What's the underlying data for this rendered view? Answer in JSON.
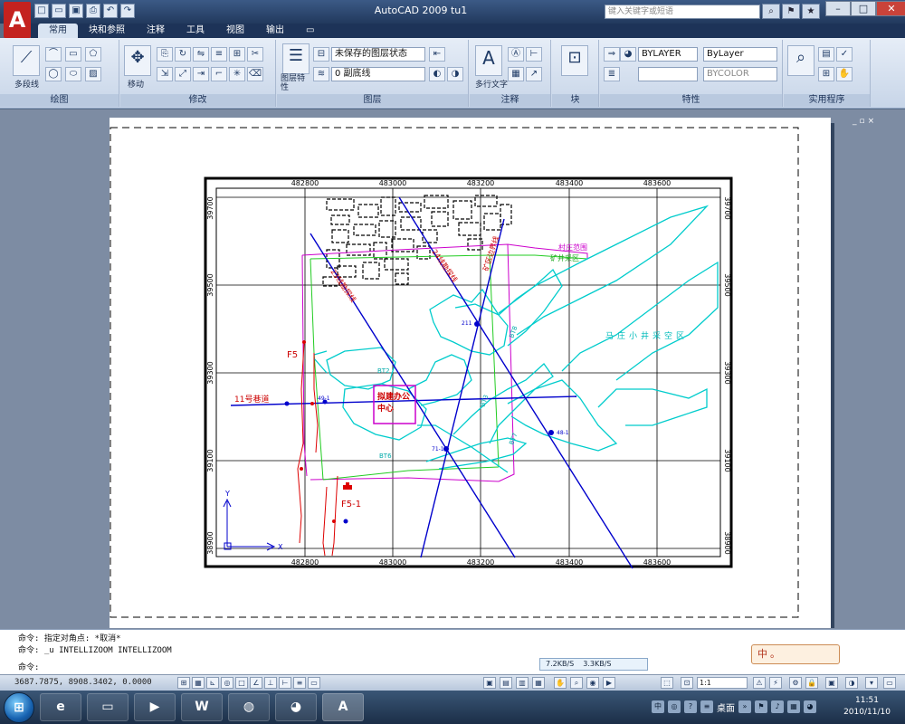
{
  "window": {
    "title": "AutoCAD 2009 tu1",
    "help_search_placeholder": "键入关键字或短语",
    "app_letter": "A"
  },
  "quick_access": [
    "new-icon",
    "open-icon",
    "save-icon",
    "plot-icon",
    "undo-icon",
    "redo-icon"
  ],
  "ribbon": {
    "tabs": [
      "常用",
      "块和参照",
      "注释",
      "工具",
      "视图",
      "输出"
    ],
    "active_tab": 0,
    "panels": {
      "draw": {
        "title": "绘图",
        "polyline_label": "多段线"
      },
      "modify": {
        "title": "修改",
        "move_label": "移动"
      },
      "layers": {
        "title": "图层",
        "layer_state": "未保存的图层状态",
        "current_layer": "0 副底线",
        "layer_props_label": "图层特性"
      },
      "annotation": {
        "title": "注释",
        "mtext_label": "多行文字"
      },
      "block": {
        "title": "块"
      },
      "properties": {
        "title": "特性",
        "color": "BYLAYER",
        "linetype": "ByLayer",
        "lineweight": "",
        "plotstyle": "BYCOLOR"
      },
      "utilities": {
        "title": "实用程序"
      }
    }
  },
  "drawing": {
    "grid_x_labels": [
      "482800",
      "483000",
      "483200",
      "483400",
      "483600"
    ],
    "grid_y_labels": [
      "39700",
      "39500",
      "39300",
      "39100",
      "38900"
    ],
    "map_labels": {
      "village_boundary": "村庄范围",
      "mining_area": "矿井采区",
      "mountain_area": "马庄小井采空区",
      "planned_office": "拟建办公",
      "planned_office_2": "中心",
      "road_11": "11号巷道",
      "f5": "F5",
      "f5_1": "F5-1",
      "bt2": "BT2",
      "bt3": "BT3",
      "bt6": "BT6",
      "bt7": "BT7",
      "bt8": "BT8",
      "line_1": "23线勘探线",
      "line_2": "24线勘探线",
      "line_3": "矿区边界线",
      "hole_211": "211",
      "hole_71": "71-1",
      "hole_48": "48-1",
      "hole_49": "49-1"
    },
    "ucs_x": "X",
    "ucs_y": "Y"
  },
  "command": {
    "lines": [
      "命令: 指定对角点: *取消*",
      "命令: _u INTELLIZOOM INTELLIZOOM",
      "命令:"
    ]
  },
  "speed": {
    "down": "7.2KB/S",
    "up": "3.3KB/S"
  },
  "ime": {
    "text": "中。"
  },
  "status": {
    "coords": "3687.7875, 8908.3402, 0.0000",
    "scale": "1:1",
    "model_label": "模型"
  },
  "taskbar": {
    "desktop_label": "桌面",
    "time": "11:51",
    "date": "2010/11/10"
  },
  "colors": {
    "accent": "#c4221f",
    "grid": "#000000",
    "boundary_magenta": "#cc00cc",
    "area_cyan": "#00cccc",
    "mining_green": "#22cc22",
    "lines_blue": "#0000cc",
    "fault_red": "#dd0000"
  }
}
